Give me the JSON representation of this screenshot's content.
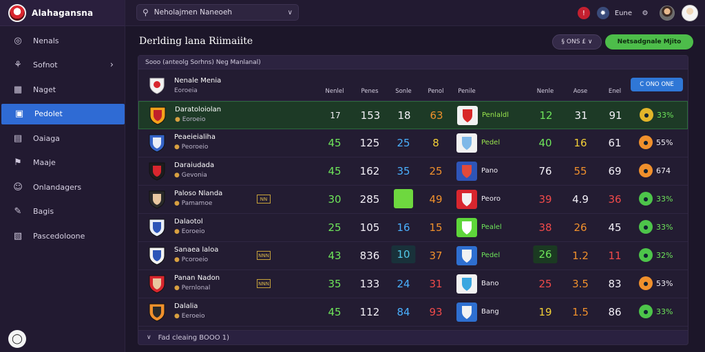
{
  "app": {
    "name": "Alahagansna"
  },
  "sidebar": {
    "items": [
      {
        "label": "Nenals",
        "icon": "circle-icon"
      },
      {
        "label": "Sofnot",
        "icon": "figure-icon",
        "chevron": true
      },
      {
        "label": "Naget",
        "icon": "grid-icon"
      },
      {
        "label": "Pedolet",
        "icon": "calendar-icon",
        "active": true
      },
      {
        "label": "Oaiaga",
        "icon": "briefcase-icon"
      },
      {
        "label": "Maaje",
        "icon": "medal-icon"
      },
      {
        "label": "Onlandagers",
        "icon": "people-icon"
      },
      {
        "label": "Bagis",
        "icon": "pen-icon"
      },
      {
        "label": "Pascedoloone",
        "icon": "chart-icon"
      }
    ]
  },
  "topbar": {
    "search_value": "Neholajmen Naneoeh",
    "user_label": "Eune"
  },
  "main": {
    "title": "Derlding lana Riimaiite",
    "filter_label": "§ ONS £ ∨",
    "action_label": "Netsadgnale Mjito",
    "panel_head": "Sooo (anteolg Sorhns) Neg Manlanal)",
    "header": {
      "name": "Nenale Menia",
      "sub": "Eoroeia",
      "cols": [
        "Nenlel",
        "Penes",
        "Sonle",
        "Penol",
        "Penile",
        "Nenle",
        "Aose",
        "Enel"
      ],
      "pill": "C ONO ONE"
    },
    "footer": "Fad cleaing BOOO 1)"
  },
  "rows": [
    {
      "name": "Daratoloiolan",
      "sub": "Eoroeio",
      "tag": "",
      "crest": [
        "#f2a21b",
        "#c0202a"
      ],
      "c1": "17",
      "c1c": "c-white",
      "c1s": true,
      "c2": "153",
      "c2c": "c-white",
      "c3": "18",
      "c3c": "c-white",
      "c4": "63",
      "c4c": "c-orange",
      "club": [
        "#f2f2f2",
        "#d82828"
      ],
      "clubname": "Penlaldl",
      "clubc": "c-lime",
      "c5": "12",
      "c5c": "c-green",
      "c6": "31",
      "c6c": "c-white",
      "c7": "91",
      "c7c": "c-white",
      "dot": "#e2b52a",
      "pct": "33%",
      "pctc": "c-green",
      "hl": true
    },
    {
      "name": "Peaeieialiha",
      "sub": "Peoroeio",
      "tag": "",
      "crest": [
        "#3564c8",
        "#e9eef7"
      ],
      "c1": "45",
      "c1c": "c-green",
      "c2": "125",
      "c2c": "c-white",
      "c3": "25",
      "c3c": "c-blue",
      "c4": "8",
      "c4c": "c-yellow",
      "club": [
        "#f2f2f2",
        "#7fb8e8"
      ],
      "clubname": "Pedel",
      "clubc": "c-lime",
      "c5": "40",
      "c5c": "c-green",
      "c6": "16",
      "c6c": "c-yellow",
      "c7": "61",
      "c7c": "c-white",
      "dot": "#f0902c",
      "pct": "55%",
      "pctc": "c-white"
    },
    {
      "name": "Daraiudada",
      "sub": "Gevonia",
      "tag": "",
      "crest": [
        "#1d1d1d",
        "#d8262e"
      ],
      "c1": "45",
      "c1c": "c-green",
      "c2": "162",
      "c2c": "c-white",
      "c3": "35",
      "c3c": "c-blue",
      "c4": "25",
      "c4c": "c-orange",
      "club": [
        "#2e55b8",
        "#e24a3a"
      ],
      "clubname": "Pano",
      "clubc": "c-white",
      "c5": "76",
      "c5c": "c-white",
      "c6": "55",
      "c6c": "c-orange",
      "c7": "69",
      "c7c": "c-white",
      "dot": "#f0902c",
      "pct": "674",
      "pctc": "c-white"
    },
    {
      "name": "Paloso Nlanda",
      "sub": "Pamamoe",
      "tag": "NN",
      "crest": [
        "#2a2a2a",
        "#e8c7a0"
      ],
      "c1": "30",
      "c1c": "c-green",
      "c2": "285",
      "c2c": "c-white",
      "c3": "",
      "c3c": "",
      "c3box": "#6ed83f",
      "c4": "49",
      "c4c": "c-orange",
      "club": [
        "#d8262e",
        "#f2f2f2"
      ],
      "clubname": "Peoro",
      "clubc": "c-white",
      "c5": "39",
      "c5c": "c-red",
      "c6": "4.9",
      "c6c": "c-white",
      "c7": "36",
      "c7c": "c-red",
      "dot": "#4dc44a",
      "pct": "33%",
      "pctc": "c-green"
    },
    {
      "name": "Dalaotol",
      "sub": "Eoroeio",
      "tag": "",
      "crest": [
        "#e9eef7",
        "#2c55b8"
      ],
      "c1": "25",
      "c1c": "c-green",
      "c2": "105",
      "c2c": "c-white",
      "c3": "16",
      "c3c": "c-blue",
      "c4": "15",
      "c4c": "c-orange",
      "club": [
        "#5ed63a",
        "#ffffff"
      ],
      "clubname": "Pealel",
      "clubc": "c-green",
      "c5": "38",
      "c5c": "c-red",
      "c6": "26",
      "c6c": "c-orange",
      "c7": "45",
      "c7c": "c-white",
      "dot": "#4dc44a",
      "pct": "33%",
      "pctc": "c-green"
    },
    {
      "name": "Sanaea laloa",
      "sub": "Pcoroeio",
      "tag": "NNN",
      "crest": [
        "#f2f2f2",
        "#2c55b8"
      ],
      "c1": "43",
      "c1c": "c-green",
      "c2": "836",
      "c2c": "c-white",
      "c3": "10",
      "c3c": "c-cyan",
      "c3bg": "#19313a",
      "c4": "37",
      "c4c": "c-orange",
      "club": [
        "#2e6fd0",
        "#f2f2f2"
      ],
      "clubname": "Pedel",
      "clubc": "c-green",
      "c5": "26",
      "c5c": "c-green",
      "c5bg": "#1b3a22",
      "c6": "1.2",
      "c6c": "c-orange",
      "c7": "11",
      "c7c": "c-red",
      "dot": "#4dc44a",
      "pct": "32%",
      "pctc": "c-green"
    },
    {
      "name": "Panan Nadon",
      "sub": "Pernlonal",
      "tag": "NNN",
      "crest": [
        "#d8262e",
        "#e8c7a0"
      ],
      "c1": "35",
      "c1c": "c-green",
      "c2": "133",
      "c2c": "c-white",
      "c3": "24",
      "c3c": "c-blue",
      "c4": "31",
      "c4c": "c-red",
      "club": [
        "#f2f2f2",
        "#3aa6e0"
      ],
      "clubname": "Bano",
      "clubc": "c-white",
      "c5": "25",
      "c5c": "c-red",
      "c6": "3.5",
      "c6c": "c-orange",
      "c7": "83",
      "c7c": "c-white",
      "dot": "#f0902c",
      "pct": "53%",
      "pctc": "c-white"
    },
    {
      "name": "Dalalia",
      "sub": "Eeroeio",
      "tag": "",
      "crest": [
        "#f0902c",
        "#2a2a2a"
      ],
      "c1": "45",
      "c1c": "c-green",
      "c2": "112",
      "c2c": "c-white",
      "c3": "84",
      "c3c": "c-blue",
      "c4": "93",
      "c4c": "c-red",
      "club": [
        "#2e6fd0",
        "#f2f2f2"
      ],
      "clubname": "Bang",
      "clubc": "c-white",
      "c5": "19",
      "c5c": "c-yellow",
      "c6": "1.5",
      "c6c": "c-orange",
      "c7": "86",
      "c7c": "c-white",
      "dot": "#4dc44a",
      "pct": "33%",
      "pctc": "c-green"
    }
  ]
}
